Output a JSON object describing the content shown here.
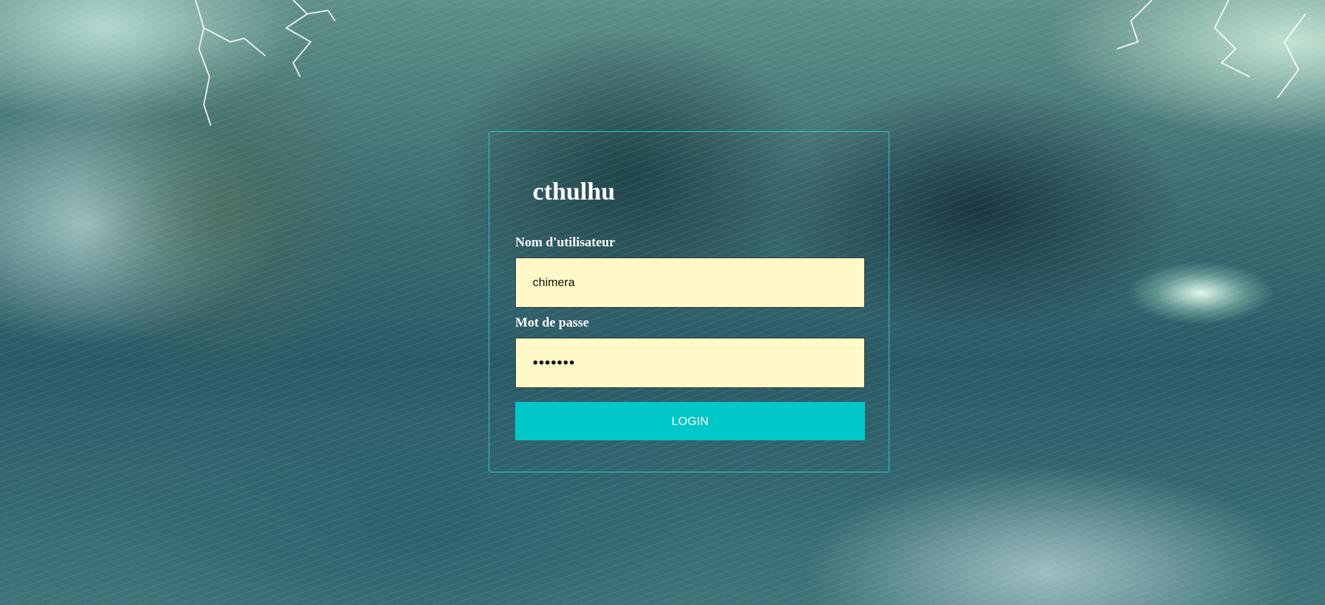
{
  "app": {
    "title": "cthulhu"
  },
  "form": {
    "username_label": "Nom d'utilisateur",
    "username_value": "chimera",
    "password_label": "Mot de passe",
    "password_value": "•••••••",
    "login_label": "LOGIN"
  },
  "colors": {
    "accent": "#00c8c8",
    "field_background": "#fff9c7",
    "card_border": "#2ac9c9"
  }
}
